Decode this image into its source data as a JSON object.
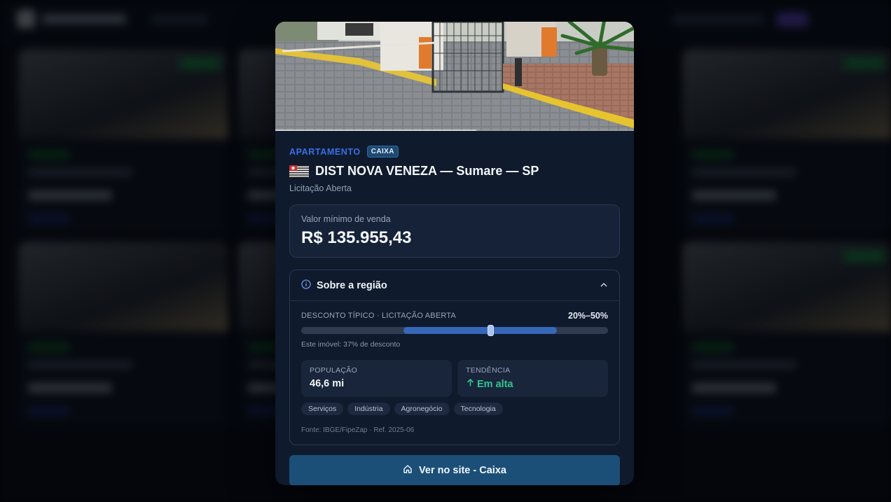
{
  "property": {
    "type_label": "APARTAMENTO",
    "source_badge": "CAIXA",
    "title": "DIST NOVA VENEZA — Sumare — SP",
    "status": "Licitação Aberta"
  },
  "price": {
    "label": "Valor mínimo de venda",
    "value": "R$ 135.955,43"
  },
  "region": {
    "title": "Sobre a região",
    "discount_label": "DESCONTO TÍPICO · LICITAÇÃO ABERTA",
    "discount_range": "20%–50%",
    "typical_range_percent": [
      20,
      50
    ],
    "property_discount_percent": 37,
    "property_note": "Este imóvel: 37% de desconto",
    "stats": [
      {
        "label": "POPULAÇÃO",
        "value": "46,6 mi"
      },
      {
        "label": "TENDÊNCIA",
        "value": "Em alta"
      }
    ],
    "tags": [
      "Serviços",
      "Indústria",
      "Agronegócio",
      "Tecnologia"
    ],
    "source": "Fonte: IBGE/FipeZap · Ref. 2025-06"
  },
  "cta": {
    "label": "Ver no site - Caixa"
  },
  "colors": {
    "accent": "#3b6fe8",
    "trend_up": "#34c38f",
    "cta_bg": "#1b4f78"
  },
  "icons": {
    "region_info": "info-circle-icon",
    "collapse": "chevron-up-icon",
    "trend": "arrow-up-icon",
    "cta": "home-icon",
    "flag": "sao-paulo-flag-icon"
  }
}
